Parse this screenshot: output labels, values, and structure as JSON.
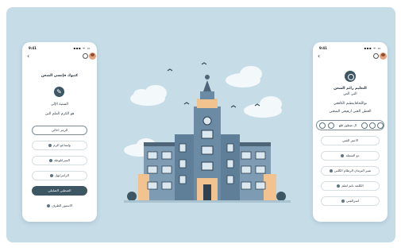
{
  "status": {
    "time": "9:41",
    "signal": "▪▪▪ ᯤ ▭"
  },
  "left_screen": {
    "title": "كنبوك فإنسي الشعن",
    "subtitle": "السنية الإلى",
    "section": "هو الكرم الملم الني",
    "options": [
      {
        "label": "الرمز اخالي",
        "style": "outline"
      },
      {
        "label": "ولساعو الرم",
        "style": "plain"
      },
      {
        "label": "السرابلوطة",
        "style": "plain"
      },
      {
        "label": "الرامرانهل",
        "style": "plain"
      },
      {
        "label": "الصطيي الصلبلي",
        "style": "dark"
      },
      {
        "label": "الاستور الطرف",
        "style": "plain"
      }
    ]
  },
  "right_screen": {
    "title": "التعليم رائم الشعن",
    "subtitle": "الني الص",
    "line1": "بواللحاقاينطبم الكافعي",
    "line2": "العطن العني ارهيعي الشعني",
    "category_label": "ال صطور قلع",
    "options": [
      {
        "label": "الاسر الفني"
      },
      {
        "label": "دو الشعلة"
      },
      {
        "label": "شير الترمان الرطام الكلبي"
      },
      {
        "label": "الكلمه تانم لعلم"
      },
      {
        "label": "اسرالفتي"
      }
    ]
  },
  "colors": {
    "background": "#c6dde8",
    "accent_dark": "#3c5663",
    "building_blue": "#5f7f99",
    "building_peach": "#f2c38e",
    "cloud": "#f3f8fb"
  },
  "icons": [
    "back-icon",
    "settings-icon",
    "avatar",
    "edit-icon",
    "logo-icon",
    "dot-icon",
    "bird-icon"
  ]
}
